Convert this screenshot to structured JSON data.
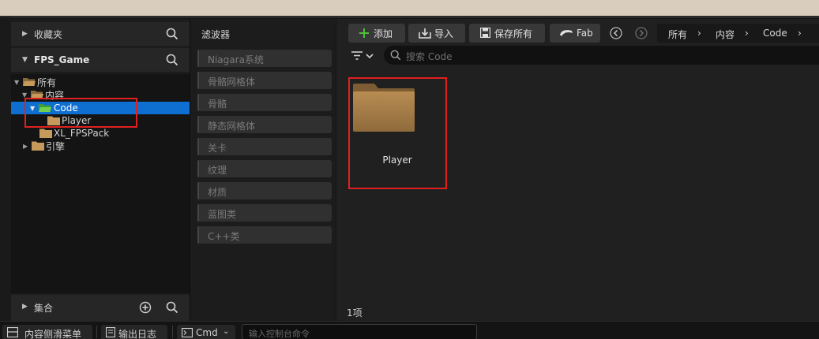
{
  "sidebar": {
    "favorites_label": "收藏夹",
    "project_label": "FPS_Game",
    "tree": [
      {
        "label": "所有"
      },
      {
        "label": "内容"
      },
      {
        "label": "Code"
      },
      {
        "label": "Player"
      },
      {
        "label": "XL_FPSPack"
      },
      {
        "label": "引擎"
      }
    ],
    "collections_label": "集合"
  },
  "filters": {
    "title": "滤波器",
    "items": [
      "Niagara系统",
      "骨骼网格体",
      "骨骼",
      "静态网格体",
      "关卡",
      "纹理",
      "材质",
      "蓝图类",
      "C++类"
    ]
  },
  "toolbar": {
    "add_label": "添加",
    "import_label": "导入",
    "save_all_label": "保存所有",
    "fab_label": "Fab",
    "breadcrumb": [
      "所有",
      "内容",
      "Code"
    ]
  },
  "search": {
    "placeholder": "搜索 Code"
  },
  "assets": [
    {
      "name": "Player",
      "type": "folder"
    }
  ],
  "status": {
    "item_count": "1项"
  },
  "bottom_bar": {
    "content_drawer_label": "内容侧滑菜单",
    "output_log_label": "输出日志",
    "cmd_label": "Cmd",
    "console_placeholder": "输入控制台命令"
  },
  "colors": {
    "selection": "#0f6fd1",
    "highlight": "#e02020",
    "folder": "#c59a5a",
    "add_icon": "#4fbf3a"
  }
}
